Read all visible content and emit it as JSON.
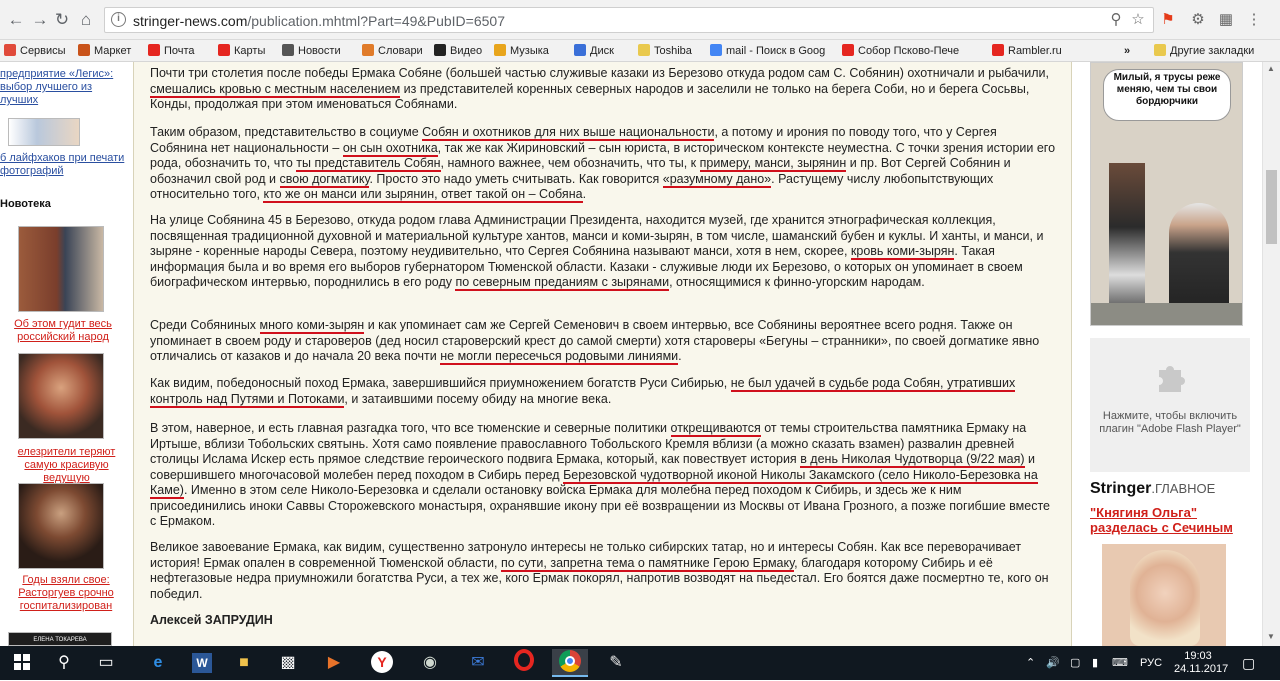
{
  "browser": {
    "url_host": "stringer-news.com",
    "url_path": "/publication.mhtml?Part=49&PubID=6507"
  },
  "bookmarks": [
    {
      "label": "Сервисы",
      "icon": "apps-icon",
      "color": "#e04a3a"
    },
    {
      "label": "Маркет",
      "icon": "market-icon",
      "color": "#c9531a"
    },
    {
      "label": "Почта",
      "icon": "yandex-icon",
      "color": "#e52620"
    },
    {
      "label": "Карты",
      "icon": "map-pin-icon",
      "color": "#e52620"
    },
    {
      "label": "Новости",
      "icon": "news-icon",
      "color": "#555555"
    },
    {
      "label": "Словари",
      "icon": "dictionary-icon",
      "color": "#e07b2a"
    },
    {
      "label": "Видео",
      "icon": "video-icon",
      "color": "#222222"
    },
    {
      "label": "Музыка",
      "icon": "music-icon",
      "color": "#e8a51c"
    },
    {
      "label": "Диск",
      "icon": "disk-icon",
      "color": "#3a6fd8"
    },
    {
      "label": "Toshiba",
      "icon": "folder-icon",
      "color": "#e9c94e"
    },
    {
      "label": "mail - Поиск в Goog",
      "icon": "google-icon",
      "color": "#4285f4"
    },
    {
      "label": "Собор Псково-Пече",
      "icon": "yandex-icon",
      "color": "#e52620"
    },
    {
      "label": "Rambler.ru",
      "icon": "rambler-icon",
      "color": "#e52620"
    }
  ],
  "bookmarks_more": "»",
  "bookmarks_other": "Другие закладки",
  "left_sidebar": {
    "link1": "предприятие «Легис»: выбор лучшего из лучших",
    "link2": "б лайфхаков при печати фотографий",
    "section": "Новотека",
    "news1": "Об этом гудит весь российский народ",
    "news2": "елезрители теряют самую красивую ведущую",
    "news3": "Годы взяли свое: Расторгуев срочно госпитализирован",
    "bottom_cap": "ЕЛЕНА ТОКАРЕВА"
  },
  "article": {
    "p1": [
      {
        "t": "Почти три столетия после победы Ермака Собяне (большей частью служивые казаки из Березово откуда родом сам С. Собянин) охотничали и рыбачили, "
      },
      {
        "t": "смешались кровью с местным населением",
        "u": true
      },
      {
        "t": " из представителей коренных северных народов и заселили не только на берега Соби, но и берега Сосьвы, Конды, продолжая при этом именоваться Собянами."
      }
    ],
    "p2": [
      {
        "t": "Таким образом, представительство в социуме "
      },
      {
        "t": "Собян и охотников для них выше национальности",
        "u": true
      },
      {
        "t": ", а потому и ирония по поводу того, что у Сергея Собянина нет национальности – "
      },
      {
        "t": "он сын охотника",
        "u": true
      },
      {
        "t": ", так же как Жириновский – сын юриста, в историческом контексте неуместна. С точки зрения истории его рода, обозначить то, что "
      },
      {
        "t": "ты представитель Собян",
        "u": true
      },
      {
        "t": ", намного важнее, чем обозначить, что ты, к "
      },
      {
        "t": "примеру, манси, зырянин",
        "u": true
      },
      {
        "t": " и пр. Вот Сергей Собянин и обозначил свой род и "
      },
      {
        "t": "свою догматику",
        "u": true
      },
      {
        "t": ". Просто это надо уметь считывать. Как говорится "
      },
      {
        "t": "«разумному дано»",
        "u": true
      },
      {
        "t": ". Растущему числу любопытствующих относительно того, "
      },
      {
        "t": "кто же он манси или зырянин, ответ такой он – Собяна",
        "u": true
      },
      {
        "t": "."
      }
    ],
    "p3": [
      {
        "t": "На улице Собянина 45 в Березово, откуда родом глава Администрации Президента, находится музей, где хранится этнографическая коллекция, посвященная традиционной духовной и материальной культуре хантов, манси и коми-зырян, в том числе, шаманский бубен и куклы. И ханты, и манси, и зыряне - коренные народы Севера, поэтому неудивительно, что Сергея Собянина называют манси, хотя в нем, скорее, "
      },
      {
        "t": "кровь коми-зырян",
        "u": true
      },
      {
        "t": ". Такая информация была и во время его выборов губернатором Тюменской области. Казаки - служивые люди их Березово, о которых он упоминает в своем биографическом интервью, породнились в его роду "
      },
      {
        "t": "по северным преданиям с зырянами",
        "u": true
      },
      {
        "t": ", относящимися к финно-угорским народам."
      }
    ],
    "p4": [
      {
        "t": "Среди Собяниных "
      },
      {
        "t": "много коми-зырян",
        "u": true
      },
      {
        "t": " и как упоминает сам же Сергей Семенович в своем интервью, все Собянины вероятнее всего родня. Также он упоминает в своем роду и староверов (дед носил староверский крест до самой смерти) хотя староверы «Бегуны – странники», по своей догматике явно отличались от казаков и до начала 20 века почти "
      },
      {
        "t": "не могли пересечься родовыми линиями",
        "u": true
      },
      {
        "t": "."
      }
    ],
    "p5": [
      {
        "t": "Как видим, победоносный поход Ермака, завершившийся приумножением богатств Руси Сибирью, "
      },
      {
        "t": "не был удачей в судьбе рода Собян, утративших контроль над Путями и Потоками",
        "u": true
      },
      {
        "t": ", и затаившими посему обиду на многие века."
      }
    ],
    "p6": [
      {
        "t": "В этом, наверное, и есть главная разгадка того, что все тюменские и северные политики "
      },
      {
        "t": "открещиваются",
        "u": true
      },
      {
        "t": " от темы строительства памятника Ермаку на Иртыше, вблизи Тобольских святынь. Хотя само появление православного Тобольского Кремля вблизи (а можно сказать взамен) развалин древней столицы Ислама Искер есть прямое следствие героического подвига Ермака, который, как повествует история "
      },
      {
        "t": "в день Николая Чудотворца (9/22 мая)",
        "u": true
      },
      {
        "t": " и совершившего многочасовой молебен перед походом в Сибирь перед "
      },
      {
        "t": "Березовской чудотворной иконой Николы Закамского (село Николо-Березовка на Каме)",
        "u": true
      },
      {
        "t": ". Именно в этом селе Николо-Березовка и сделали остановку войска Ермака для молебна перед походом к Сибирь, и здесь же к ним присоединились иноки Саввы Сторожевского монастыря, охранявшие икону при её возвращении из Москвы от Ивана Грозного, а позже погибшие вместе с Ермаком."
      }
    ],
    "p7": [
      {
        "t": "Великое завоевание Ермака, как видим, существенно затронуло интересы не только сибирских татар, но и интересы Собян. Как все переворачивает история! Ермак опален в современной Тюменской области, "
      },
      {
        "t": "по сути, запретна тема о памятнике Герою Ермаку",
        "u": true
      },
      {
        "t": ", благодаря которому Сибирь и её нефтегазовые недра приумножили богатства Руси, а тех же, кого Ермак покорял, напротив возводят на пьедестал. Его боятся даже посмертно те, кого он победил."
      }
    ],
    "signature": "Алексей ЗАПРУДИН"
  },
  "right_sidebar": {
    "ad_caption": "Милый, я трусы реже меняю, чем ты свои бордюрчики",
    "flash_text": "Нажмите, чтобы включить плагин \"Adobe Flash Player\"",
    "brand_main": "Stringer",
    "brand_sub": ".ГЛАВНОЕ",
    "headline": "\"Княгиня Ольга\" разделась с Сечиным"
  },
  "taskbar": {
    "lang": "РУС",
    "time": "19:03",
    "date": "24.11.2017"
  }
}
